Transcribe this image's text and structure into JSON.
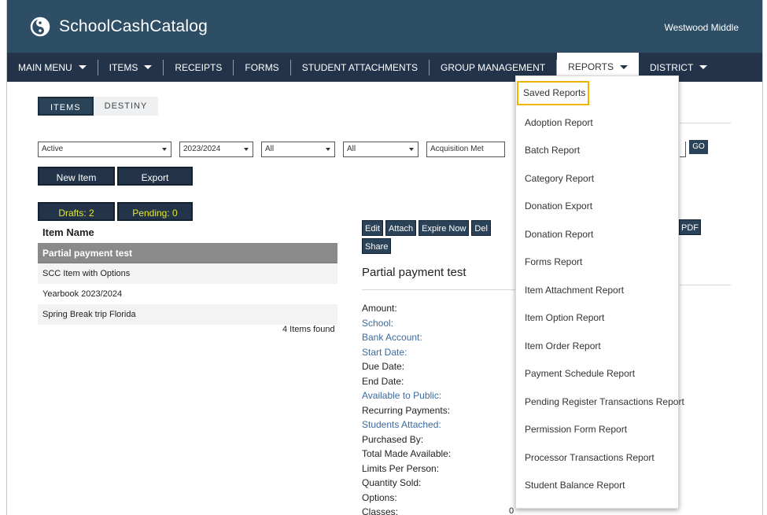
{
  "app": {
    "name": "SchoolCashCatalog",
    "school": "Westwood Middle"
  },
  "nav": [
    {
      "label": "MAIN MENU",
      "caret": true
    },
    {
      "label": "ITEMS",
      "caret": true
    },
    {
      "label": "RECEIPTS",
      "caret": false
    },
    {
      "label": "FORMS",
      "caret": false
    },
    {
      "label": "STUDENT ATTACHMENTS",
      "caret": false
    },
    {
      "label": "GROUP MANAGEMENT",
      "caret": false
    },
    {
      "label": "REPORTS",
      "caret": true
    },
    {
      "label": "DISTRICT",
      "caret": true
    }
  ],
  "toggles": {
    "items": "ITEMS",
    "destiny": "DESTINY"
  },
  "filters": {
    "status": "Active",
    "year": "2023/2024",
    "filter3": "All",
    "filter4": "All",
    "filter5": "Acquisition Met"
  },
  "search_go": "GO",
  "buttons": {
    "new_item": "New Item",
    "export": "Export",
    "drafts": "Drafts: 2",
    "pending": "Pending: 0"
  },
  "list": {
    "header": "Item Name",
    "rows": [
      "Partial payment test",
      "SCC Item with Options",
      "Yearbook 2023/2024",
      "Spring Break trip Florida"
    ],
    "found": "4 Items found"
  },
  "detail": {
    "actions": [
      "Edit",
      "Attach",
      "Expire Now",
      "Del"
    ],
    "share": "Share",
    "pdf": "PDF",
    "title": "Partial payment test",
    "fields": [
      {
        "label": "Amount:",
        "link": false
      },
      {
        "label": "School:",
        "link": true
      },
      {
        "label": "Bank Account:",
        "link": true
      },
      {
        "label": "Start Date:",
        "link": true
      },
      {
        "label": "Due Date:",
        "link": false
      },
      {
        "label": "End Date:",
        "link": false
      },
      {
        "label": "Available to Public:",
        "link": true
      },
      {
        "label": "Recurring Payments:",
        "link": false
      },
      {
        "label": "Students Attached:",
        "link": true
      },
      {
        "label": "Purchased By:",
        "link": false
      },
      {
        "label": "Total Made Available:",
        "link": false
      },
      {
        "label": "Limits Per Person:",
        "link": false
      },
      {
        "label": "Quantity Sold:",
        "link": false
      },
      {
        "label": "Options:",
        "link": false
      },
      {
        "label": "Classes:",
        "link": false
      }
    ],
    "zero_value": "0"
  },
  "reports_menu": [
    "Saved Reports",
    "Adoption Report",
    "Batch Report",
    "Category Report",
    "Donation Export",
    "Donation Report",
    "Forms Report",
    "Item Attachment Report",
    "Item Option Report",
    "Item Order Report",
    "Payment Schedule Report",
    "Pending Register Transactions Report",
    "Permission Form Report",
    "Processor Transactions Report",
    "Student Balance Report"
  ],
  "colors": {
    "header": "#2e4e65",
    "nav": "#23344a",
    "highlight": "#f0b400",
    "badge_text": "#e2e82e"
  }
}
